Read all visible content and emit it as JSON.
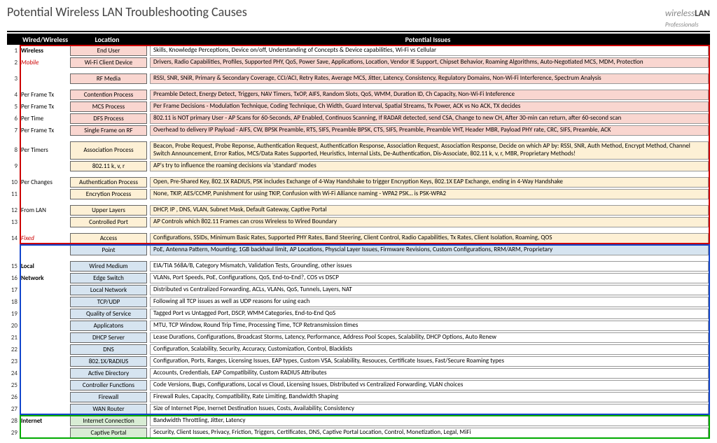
{
  "title": "Potential Wireless LAN Troubleshooting Causes",
  "logo_a": "wireless",
  "logo_b": "LAN",
  "logo_c": "Professionals",
  "cols": {
    "ww": "Wired/Wireless",
    "loc": "Location",
    "iss": "Potential Issues"
  },
  "sections": [
    {
      "box": "red",
      "pre_gap": false,
      "rows": [
        {
          "n": "1",
          "ww": "Wireless",
          "ww_bold": true,
          "loc": "End User",
          "loc_bg": "bg-pink",
          "iss": "Skills, Knowledge Perceptions, Device on/off, Understanding of Concepts & Device capabilities, Wi-Fi vs Cellular",
          "iss_bg": ""
        },
        {
          "n": "2",
          "ww": "Mobile",
          "ww_cls": "red",
          "loc": "Wi-Fi Client Device",
          "loc_bg": "bg-pink",
          "iss": "Drivers, Radio Capabilities, Profiles, Supported PHY, QoS, Power Save, Applications, Location, Vendor IE Support, Chipset Behavior,  Roaming Algorithms, Auto-Negotiated MCS, MDM, Protection",
          "iss_bg": "bg-pink"
        },
        {
          "gap": true
        },
        {
          "n": "3",
          "ww": "",
          "loc": "RF Media",
          "loc_bg": "bg-pink",
          "iss": "RSSI, SNR, SNiR, Primary & Secondary Coverage, CCI/ACI, Retry Rates, Average MCS, Jitter, Latency, Consistency, Regulatory Domains, Non-Wi-Fi Interference, Spectrum Analysis",
          "iss_bg": "bg-pink"
        },
        {
          "gap": true
        },
        {
          "n": "4",
          "ww": "Per Frame Tx",
          "loc": "Contention Process",
          "loc_bg": "bg-pink",
          "iss": "Preamble Detect, Energy Detect, Triggers, NAV Timers, TxOP, AIFS, Random Slots, QoS, WMM, Duration ID, Ch Capacity, Non-Wi-Fi Inteference",
          "iss_bg": "bg-pink"
        },
        {
          "n": "5",
          "ww": "Per Frame Tx",
          "loc": "MCS Process",
          "loc_bg": "bg-pink",
          "iss": "Per Frame Decisions - Modulation Technique, Coding Technique, Ch Width, Guard Interval, Spatial Streams, Tx Power, ACK vs No ACK, TX decides",
          "iss_bg": "bg-pink"
        },
        {
          "n": "6",
          "ww": "Per Time",
          "loc": "DFS Process",
          "loc_bg": "bg-pink",
          "iss": "802.11 is NOT primary User - AP Scans for 60-Seconds,  AP Enabled, Continuos Scanning, If RADAR detected, send CSA, Change to new CH, After 30-min can return, after 60-second scan",
          "iss_bg": "bg-pink"
        },
        {
          "n": "7",
          "ww": "Per Frame Tx",
          "loc": "Single Frame on RF",
          "loc_bg": "bg-pink",
          "iss": "Overhead to delivery IP Payload - AIFS, CW, BPSK Preamble, RTS, SIFS, Preamble BPSK, CTS, SIFS, Preamble, Preamble VHT, Header MBR, Payload PHY rate, CRC, SIFS, Preamble, ACK",
          "iss_bg": "bg-pink"
        },
        {
          "gap": true
        },
        {
          "n": "8",
          "ww": "Per Timers",
          "loc": "Association Process",
          "loc_bg": "bg-cream",
          "iss": "Beacon, Probe Request, Probe Reponse, Authentication Request, Authentication Response, Association Request, Association Response, Decide on which AP by: RSSI, SNR, Auth Method, Encrypt Method, Channel Switch Announcement, Error Ratios, MCS/Data Rates Supported, Heuristics, Internal Lists, De-Authentication, Dis-Associate, 802.11 k, v, r, MBR, Proprietary Methods!",
          "iss_bg": "bg-cream",
          "tall": true
        },
        {
          "n": "9",
          "ww": "",
          "loc": "802.11 k, v, r",
          "loc_bg": "bg-cream",
          "iss": "AP's try to influence the roaming decisions via 'standard' modes",
          "iss_bg": "bg-cream"
        },
        {
          "gap": true
        },
        {
          "n": "10",
          "ww": "Per Changes",
          "loc": "Authentication Process",
          "loc_bg": "bg-cream",
          "iss": "Open, Pre-Shared Key, 802.1X RADIUS, PSK includes Exchange of 4-Way Handshake to trigger Encryption Keys, 802.1X EAP Exchange, ending in 4-Way Handshake",
          "iss_bg": "bg-cream"
        },
        {
          "n": "11",
          "ww": "",
          "loc": "Encrytion Process",
          "loc_bg": "bg-cream",
          "iss": "None, TKIP, AES/CCMP, Punishment for using TKIP, Confusion with Wi-Fi Alliance naming - WPA2 PSK… is PSK-WPA2",
          "iss_bg": "bg-cream"
        },
        {
          "gap": true
        },
        {
          "n": "12",
          "ww": "From LAN",
          "loc": "Upper Layers",
          "loc_bg": "bg-cream",
          "iss": "DHCP, IP , DNS, VLAN, Subnet Mask, Default Gateway, Captive Portal",
          "iss_bg": "bg-cream"
        },
        {
          "n": "13",
          "ww": "",
          "loc": "Controlled Port",
          "loc_bg": "bg-cream",
          "iss": "AP Controls which 802.11 Frames can cross Wireless to Wired Boundary",
          "iss_bg": "bg-cream"
        },
        {
          "gap": true
        },
        {
          "n": "14",
          "ww": "Fixed",
          "ww_cls": "red",
          "loc": "Access",
          "loc_bg": "bg-cream",
          "iss": "Configurations, SSIDs, Minimum Basic Rates, Supported PHY Rates, Band Steering, Client Control, Radio Capabilities, Tx Rates, Client Isolation, Roaming, QOS",
          "iss_bg": "bg-cream"
        }
      ]
    },
    {
      "box": "blue",
      "pre_gap": false,
      "rows": [
        {
          "n": "",
          "ww": "",
          "loc": "Point",
          "loc_bg": "bg-blue",
          "iss": "PoE, Antenna Pattern, Mounting, 1GB backhaul limit, AP Locations, Physcial Layer Issues, Firmware Revisions, Custom Configurations, RRM/ARM, Proprietary",
          "iss_bg": "bg-blue"
        },
        {
          "gap": true
        },
        {
          "n": "15",
          "ww": "Local",
          "ww_bold": true,
          "loc": "Wired Medium",
          "loc_bg": "bg-blue",
          "iss": "EIA/TIA 568A/B, Category Mismatch, Validation Tests, Grounding,  other issues",
          "iss_bg": ""
        },
        {
          "n": "16",
          "ww": "Network",
          "ww_bold": true,
          "loc": "Edge Switch",
          "loc_bg": "bg-blue",
          "iss": "VLANs, Port Speeds, PoE, Configurations, QoS, End-to-End?, COS vs DSCP",
          "iss_bg": ""
        },
        {
          "n": "17",
          "ww": "",
          "loc": "Local Network",
          "loc_bg": "bg-blue",
          "iss": "Distributed vs Centralized Forwarding, ACLs, VLANs, QoS, Tunnels, Layers, NAT",
          "iss_bg": ""
        },
        {
          "n": "18",
          "ww": "",
          "loc": "TCP/UDP",
          "loc_bg": "bg-blue",
          "iss": "Following all TCP issues as well as UDP reasons for using each",
          "iss_bg": ""
        },
        {
          "n": "19",
          "ww": "",
          "loc": "Quality of Service",
          "loc_bg": "bg-blue",
          "iss": "Tagged Port vs Untagged Port, DSCP, WMM Categories, End-to-End QoS",
          "iss_bg": ""
        },
        {
          "n": "20",
          "ww": "",
          "loc": "Applicatons",
          "loc_bg": "bg-blue",
          "iss": "MTU, TCP Window, Round Trip Time, Processing Time, TCP Retransmission times",
          "iss_bg": ""
        },
        {
          "n": "21",
          "ww": "",
          "loc": "DHCP Server",
          "loc_bg": "bg-blue",
          "iss": "Lease Durations, Configurations, Broadcast Storms, Latency, Performance, Address Pool Scopes, Scalability, DHCP Options, Auto Renew",
          "iss_bg": ""
        },
        {
          "n": "22",
          "ww": "",
          "loc": "DNS",
          "loc_bg": "bg-blue",
          "iss": "Configuration, Scalability, Security, Accuracy, Customization, Control, Blacklists",
          "iss_bg": ""
        },
        {
          "n": "23",
          "ww": "",
          "loc": "802.1X/RADIUS",
          "loc_bg": "bg-blue",
          "iss": "Configuration, Ports, Ranges, Licensing Issues, EAP types,  Custom VSA, Scalability, Resouces, Certificate Issues, Fast/Secure Roaming types",
          "iss_bg": ""
        },
        {
          "n": "24",
          "ww": "",
          "loc": "Active Directory",
          "loc_bg": "bg-blue",
          "iss": "Accounts, Credentials, EAP Compatibility, Custom RADIUS Attributes",
          "iss_bg": ""
        },
        {
          "n": "25",
          "ww": "",
          "loc": "Controller Functions",
          "loc_bg": "bg-blue",
          "iss": "Code Versions, Bugs, Configurations, Local vs Cloud, Licensing Issues, Distributed vs Centralized Forwarding, VLAN choices",
          "iss_bg": ""
        },
        {
          "n": "26",
          "ww": "",
          "loc": "Firewall",
          "loc_bg": "bg-blue",
          "iss": "Firewall Rules, Capacity, Compatibility, Rate Limiting, Bandwidth Shaping",
          "iss_bg": ""
        },
        {
          "n": "27",
          "ww": "",
          "loc": "WAN Router",
          "loc_bg": "bg-blue",
          "iss": "Size of Internet Pipe, Inernet Destination Issues, Costs, Availability, Consistency",
          "iss_bg": ""
        }
      ]
    },
    {
      "box": "green",
      "pre_gap": false,
      "rows": [
        {
          "n": "28",
          "ww": "Internet",
          "ww_bold": true,
          "loc": "Internet Connection",
          "loc_bg": "bg-green",
          "iss": "Bandwidth Throttling, Jitter, Latency",
          "iss_bg": ""
        },
        {
          "n": "29",
          "ww": "",
          "loc": "Captive Portal",
          "loc_bg": "bg-green",
          "iss": "Security, Client Issues, Privacy, Friction, Triggers, Certificates, DNS, Captive Portal Location, Control, Monetization, Legal, MiFi",
          "iss_bg": ""
        }
      ]
    }
  ]
}
